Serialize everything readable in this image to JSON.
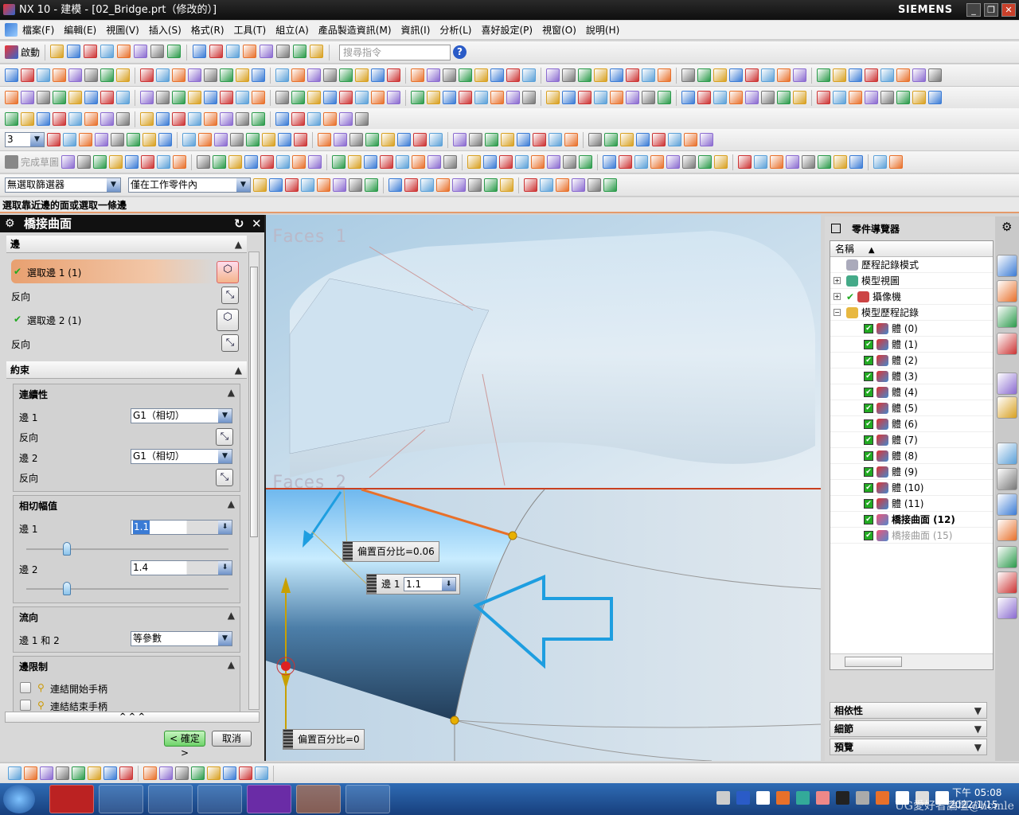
{
  "window": {
    "title": "NX 10 - 建模 - [02_Bridge.prt（修改的）]",
    "brand": "SIEMENS"
  },
  "menu": [
    "檔案(F)",
    "編輯(E)",
    "視圖(V)",
    "插入(S)",
    "格式(R)",
    "工具(T)",
    "組立(A)",
    "產品製造資訊(M)",
    "資訊(I)",
    "分析(L)",
    "喜好設定(P)",
    "視窗(O)",
    "說明(H)"
  ],
  "toolbar": {
    "start_label": "啟動",
    "search_placeholder": "搜尋指令",
    "finish_sketch": "完成草圖",
    "layer_value": "3"
  },
  "filters": {
    "selection_filter": "無選取篩選器",
    "scope": "僅在工作零件內"
  },
  "prompt": "選取靠近邊的面或選取一條邊",
  "dialog": {
    "title": "橋接曲面",
    "edges_section": "邊",
    "select_edge1": "選取邊 1 (1)",
    "reverse1": "反向",
    "select_edge2": "選取邊 2 (1)",
    "reverse2": "反向",
    "constraints_section": "約束",
    "continuity": {
      "title": "連續性",
      "edge1_label": "邊 1",
      "edge1_value": "G1（相切）",
      "reverse1": "反向",
      "edge2_label": "邊 2",
      "edge2_value": "G1（相切）",
      "reverse2": "反向"
    },
    "tangent_magnitude": {
      "title": "相切幅值",
      "edge1_label": "邊 1",
      "edge1_value": "1.1",
      "edge2_label": "邊 2",
      "edge2_value": "1.4",
      "slider1_pos": 0.2,
      "slider2_pos": 0.2
    },
    "flow": {
      "title": "流向",
      "label": "邊 1 和 2",
      "value": "等參數"
    },
    "edge_limits": {
      "title": "邊限制",
      "link_start": "連結開始手柄",
      "link_end": "連結結束手柄"
    },
    "ok": "< 確定 >",
    "cancel": "取消"
  },
  "viewport": {
    "faces1": "Faces 1",
    "faces2": "Faces 2",
    "offset1": "偏置百分比=0.06",
    "edge1_label": "邊 1",
    "edge1_value": "1.1",
    "offset0": "偏置百分比=0"
  },
  "navigator": {
    "title": "零件導覽器",
    "column": "名稱",
    "items": [
      {
        "label": "歷程記錄模式",
        "level": 0
      },
      {
        "label": "模型視圖",
        "level": 0
      },
      {
        "label": "攝像機",
        "level": 0
      },
      {
        "label": "模型歷程記錄",
        "level": 0
      },
      {
        "label": "體 (0)",
        "level": 1
      },
      {
        "label": "體 (1)",
        "level": 1
      },
      {
        "label": "體 (2)",
        "level": 1
      },
      {
        "label": "體 (3)",
        "level": 1
      },
      {
        "label": "體 (4)",
        "level": 1
      },
      {
        "label": "體 (5)",
        "level": 1
      },
      {
        "label": "體 (6)",
        "level": 1
      },
      {
        "label": "體 (7)",
        "level": 1
      },
      {
        "label": "體 (8)",
        "level": 1
      },
      {
        "label": "體 (9)",
        "level": 1
      },
      {
        "label": "體 (10)",
        "level": 1
      },
      {
        "label": "體 (11)",
        "level": 1
      },
      {
        "label": "橋接曲面 (12)",
        "level": 1,
        "bold": true
      },
      {
        "label": "橋接曲面 (15)",
        "level": 1,
        "dim": true
      }
    ],
    "panels": [
      "相依性",
      "細節",
      "預覽"
    ]
  },
  "taskbar": {
    "time": "下午 05:08",
    "date": "2022/1/15",
    "watermark": "UG愛好者論壇@hcmle"
  },
  "colors": {
    "accent": "#e8702a",
    "highlight": "#1e9ee0",
    "title_bg": "#111111"
  }
}
